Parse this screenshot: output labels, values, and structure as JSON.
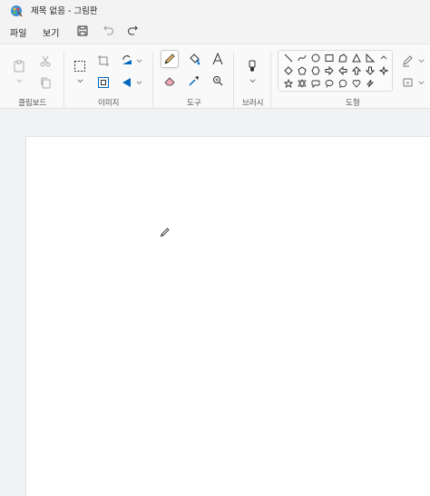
{
  "window": {
    "title": "제목 없음 - 그림판"
  },
  "menu": {
    "file_label": "파일",
    "view_label": "보기"
  },
  "quick_access": {
    "save": "save-icon",
    "undo": "undo-icon",
    "redo": "redo-icon"
  },
  "ribbon": {
    "groups": {
      "clipboard": "클립보드",
      "image": "이미지",
      "tools": "도구",
      "brushes": "브러시",
      "shapes": "도형"
    },
    "selected_tool": "pencil"
  },
  "colors": {
    "accent": "#0067c0",
    "canvas": "#ffffff",
    "workspace": "#f0f2f4"
  }
}
